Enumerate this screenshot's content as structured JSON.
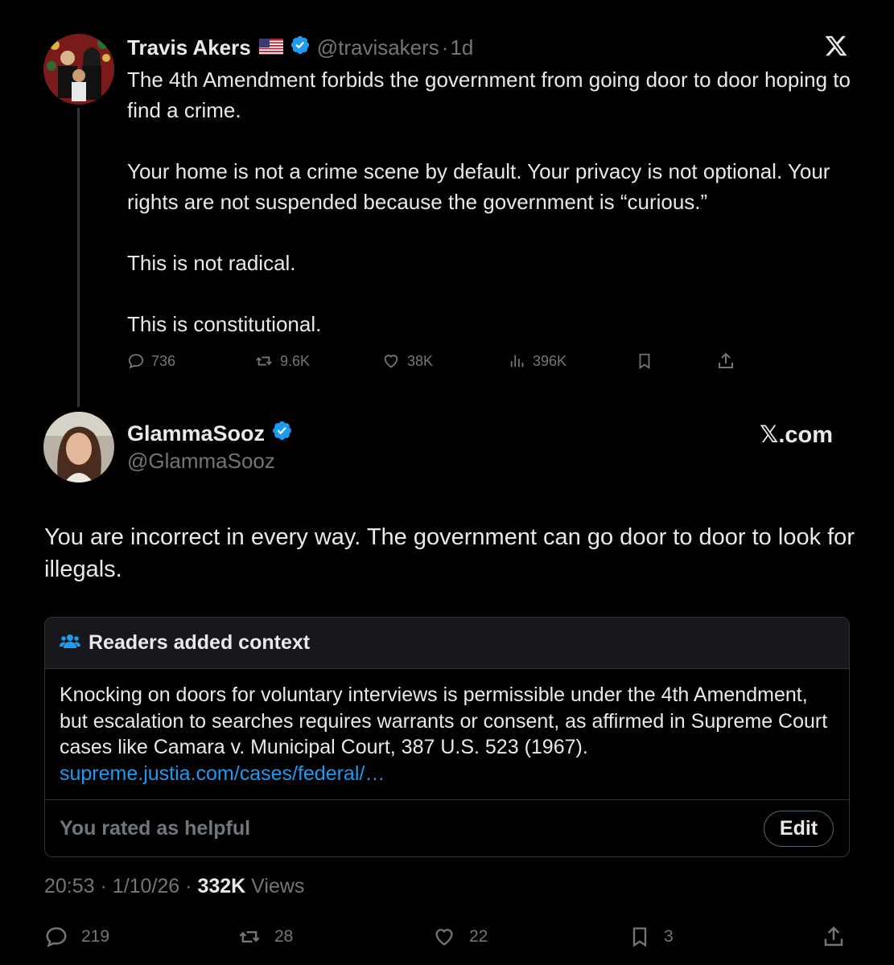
{
  "parent_tweet": {
    "display_name": "Travis Akers",
    "flag_icon": "us-flag-icon",
    "handle": "@travisakers",
    "separator": "·",
    "time": "1d",
    "text": "The 4th Amendment forbids the government from going door to door hoping to find a crime.\n\nYour home is not a crime scene by default. Your privacy is not optional. Your rights are not suspended because the government is “curious.”\n\nThis is not radical.\n\nThis is constitutional.",
    "actions": {
      "replies": "736",
      "reposts": "9.6K",
      "likes": "38K",
      "views": "396K"
    }
  },
  "reply_tweet": {
    "display_name": "GlammaSooz",
    "handle": "@GlammaSooz",
    "brand": "𝕏.com",
    "text": "You are incorrect in every way.  The government can go door to door to look for illegals."
  },
  "community_note": {
    "header": "Readers added context",
    "body": "Knocking on doors for voluntary interviews is permissible under the 4th Amendment, but escalation to searches requires warrants or consent, as affirmed in Supreme Court cases like Camara v. Municipal Court, 387 U.S. 523 (1967).",
    "link": "supreme.justia.com/cases/federal/…",
    "rated_label": "You rated as helpful",
    "edit_label": "Edit"
  },
  "meta": {
    "time": "20:53",
    "separator": "·",
    "date": "1/10/26",
    "views_count": "332K",
    "views_label": "Views"
  },
  "bottom_actions": {
    "replies": "219",
    "reposts": "28",
    "likes": "22",
    "bookmarks": "3"
  },
  "colors": {
    "background": "#000000",
    "text": "#e7e9ea",
    "secondary_text": "#71767b",
    "accent": "#1d9bf0",
    "border": "#2f3336",
    "note_header_bg": "#16181c"
  }
}
